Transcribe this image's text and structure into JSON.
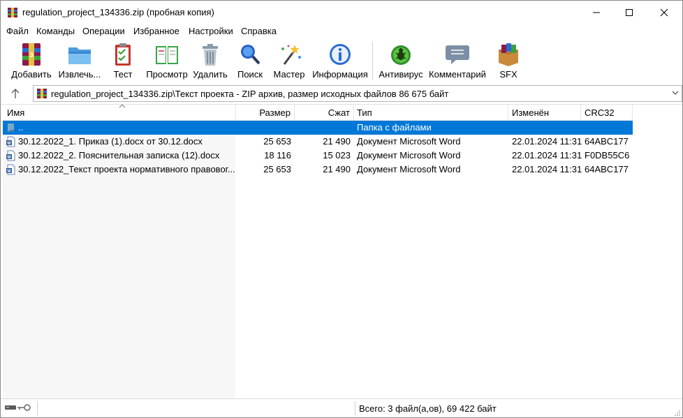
{
  "window": {
    "title": "regulation_project_134336.zip (пробная копия)"
  },
  "menu": [
    "Файл",
    "Команды",
    "Операции",
    "Избранное",
    "Настройки",
    "Справка"
  ],
  "toolbar": [
    {
      "label": "Добавить",
      "icon": "winrar-add-icon"
    },
    {
      "label": "Извлечь...",
      "icon": "folder-extract-icon"
    },
    {
      "label": "Тест",
      "icon": "clipboard-test-icon"
    },
    {
      "label": "Просмотр",
      "icon": "book-view-icon"
    },
    {
      "label": "Удалить",
      "icon": "trash-icon"
    },
    {
      "label": "Поиск",
      "icon": "magnifier-icon"
    },
    {
      "label": "Мастер",
      "icon": "magic-wand-icon"
    },
    {
      "label": "Информация",
      "icon": "info-icon"
    },
    {
      "label": "Антивирус",
      "icon": "bug-icon"
    },
    {
      "label": "Комментарий",
      "icon": "comment-icon"
    },
    {
      "label": "SFX",
      "icon": "sfx-box-icon"
    }
  ],
  "address": {
    "path": "regulation_project_134336.zip\\Текст проекта - ZIP архив, размер исходных файлов 86 675 байт"
  },
  "columns": [
    "Имя",
    "Размер",
    "Сжат",
    "Тип",
    "Изменён",
    "CRC32"
  ],
  "rows": [
    {
      "name": "..",
      "size": "",
      "packed": "",
      "type": "Папка с файлами",
      "modified": "",
      "crc": "",
      "selected": true
    },
    {
      "name": "30.12.2022_1. Приказ (1).docx от 30.12.docx",
      "size": "25 653",
      "packed": "21 490",
      "type": "Документ Microsoft Word",
      "modified": "22.01.2024 11:31",
      "crc": "64ABC177"
    },
    {
      "name": "30.12.2022_2. Пояснительная записка (12).docx",
      "size": "18 116",
      "packed": "15 023",
      "type": "Документ Microsoft Word",
      "modified": "22.01.2024 11:31",
      "crc": "F0DB55C6"
    },
    {
      "name": "30.12.2022_Текст проекта нормативного правовог...",
      "size": "25 653",
      "packed": "21 490",
      "type": "Документ Microsoft Word",
      "modified": "22.01.2024 11:31",
      "crc": "64ABC177"
    }
  ],
  "status": {
    "text": "Всего: 3 файл(а,ов), 69 422 байт"
  },
  "colors": {
    "selection": "#0078d7"
  }
}
